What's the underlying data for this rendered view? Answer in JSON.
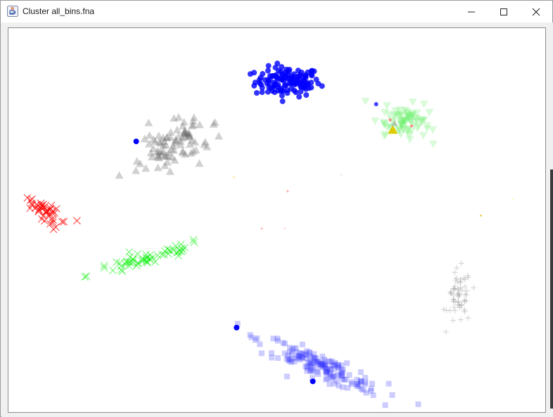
{
  "window": {
    "title": "Cluster all_bins.fna",
    "icon": "java-icon",
    "controls": [
      "minimize-icon",
      "maximize-icon",
      "close-icon"
    ]
  },
  "chart_data": {
    "type": "scatter",
    "grid": false,
    "legend": "none",
    "clusters": [
      {
        "marker": "circle",
        "color": "#0000ff",
        "opacity": 0.8,
        "cx": 0.52,
        "cy": 0.86,
        "rx": 0.055,
        "ry": 0.035,
        "n": 130,
        "tilt": 0.0
      },
      {
        "marker": "triangle-down",
        "color": "#66ee66",
        "opacity": 0.25,
        "cx": 0.74,
        "cy": 0.76,
        "rx": 0.045,
        "ry": 0.04,
        "n": 80,
        "tilt": -0.3
      },
      {
        "marker": "triangle-up",
        "color": "#666666",
        "opacity": 0.3,
        "cx": 0.31,
        "cy": 0.7,
        "rx": 0.045,
        "ry": 0.07,
        "n": 90,
        "tilt": -0.7
      },
      {
        "marker": "x",
        "color": "#ff0000",
        "opacity": 0.7,
        "cx": 0.07,
        "cy": 0.52,
        "rx": 0.02,
        "ry": 0.04,
        "n": 45,
        "tilt": 0.8
      },
      {
        "marker": "x",
        "color": "#00ee00",
        "opacity": 0.55,
        "cx": 0.26,
        "cy": 0.4,
        "rx": 0.11,
        "ry": 0.016,
        "n": 60,
        "tilt": 0.38
      },
      {
        "marker": "plus",
        "color": "#888888",
        "opacity": 0.35,
        "cx": 0.84,
        "cy": 0.3,
        "rx": 0.02,
        "ry": 0.065,
        "n": 60,
        "tilt": 0.0
      },
      {
        "marker": "square",
        "color": "#3333ff",
        "opacity": 0.25,
        "cx": 0.58,
        "cy": 0.12,
        "rx": 0.12,
        "ry": 0.025,
        "n": 170,
        "tilt": -0.55
      }
    ],
    "outliers": [
      {
        "x": 0.238,
        "y": 0.705,
        "color": "#0000ff",
        "marker": "circle",
        "size": 4
      },
      {
        "x": 0.425,
        "y": 0.22,
        "color": "#0000ff",
        "marker": "circle",
        "size": 4
      },
      {
        "x": 0.567,
        "y": 0.08,
        "color": "#0000ff",
        "marker": "circle",
        "size": 4
      },
      {
        "x": 0.685,
        "y": 0.802,
        "color": "#4444ff",
        "marker": "circle",
        "size": 3
      },
      {
        "x": 0.716,
        "y": 0.735,
        "color": "#ddcc00",
        "marker": "triangle-up",
        "size": 7
      },
      {
        "x": 0.719,
        "y": 0.752,
        "color": "#aaccaa",
        "marker": "triangle-up",
        "size": 5
      },
      {
        "x": 0.711,
        "y": 0.761,
        "color": "#ff8888",
        "marker": "circle",
        "size": 2
      },
      {
        "x": 0.751,
        "y": 0.745,
        "color": "#ff8888",
        "marker": "circle",
        "size": 2
      },
      {
        "x": 0.52,
        "y": 0.575,
        "color": "#ffaaaa",
        "marker": "circle",
        "size": 1.5
      },
      {
        "x": 0.472,
        "y": 0.478,
        "color": "#ffbbbb",
        "marker": "circle",
        "size": 1.5
      },
      {
        "x": 0.515,
        "y": 0.478,
        "color": "#ffdddd",
        "marker": "circle",
        "size": 1.5
      },
      {
        "x": 0.88,
        "y": 0.512,
        "color": "#eecc66",
        "marker": "circle",
        "size": 1.5
      },
      {
        "x": 0.42,
        "y": 0.612,
        "color": "#fff3cc",
        "marker": "circle",
        "size": 2
      },
      {
        "x": 0.62,
        "y": 0.617,
        "color": "#f3f3f3",
        "marker": "circle",
        "size": 2
      },
      {
        "x": 0.94,
        "y": 0.555,
        "color": "#fffbe0",
        "marker": "circle",
        "size": 2
      }
    ]
  }
}
